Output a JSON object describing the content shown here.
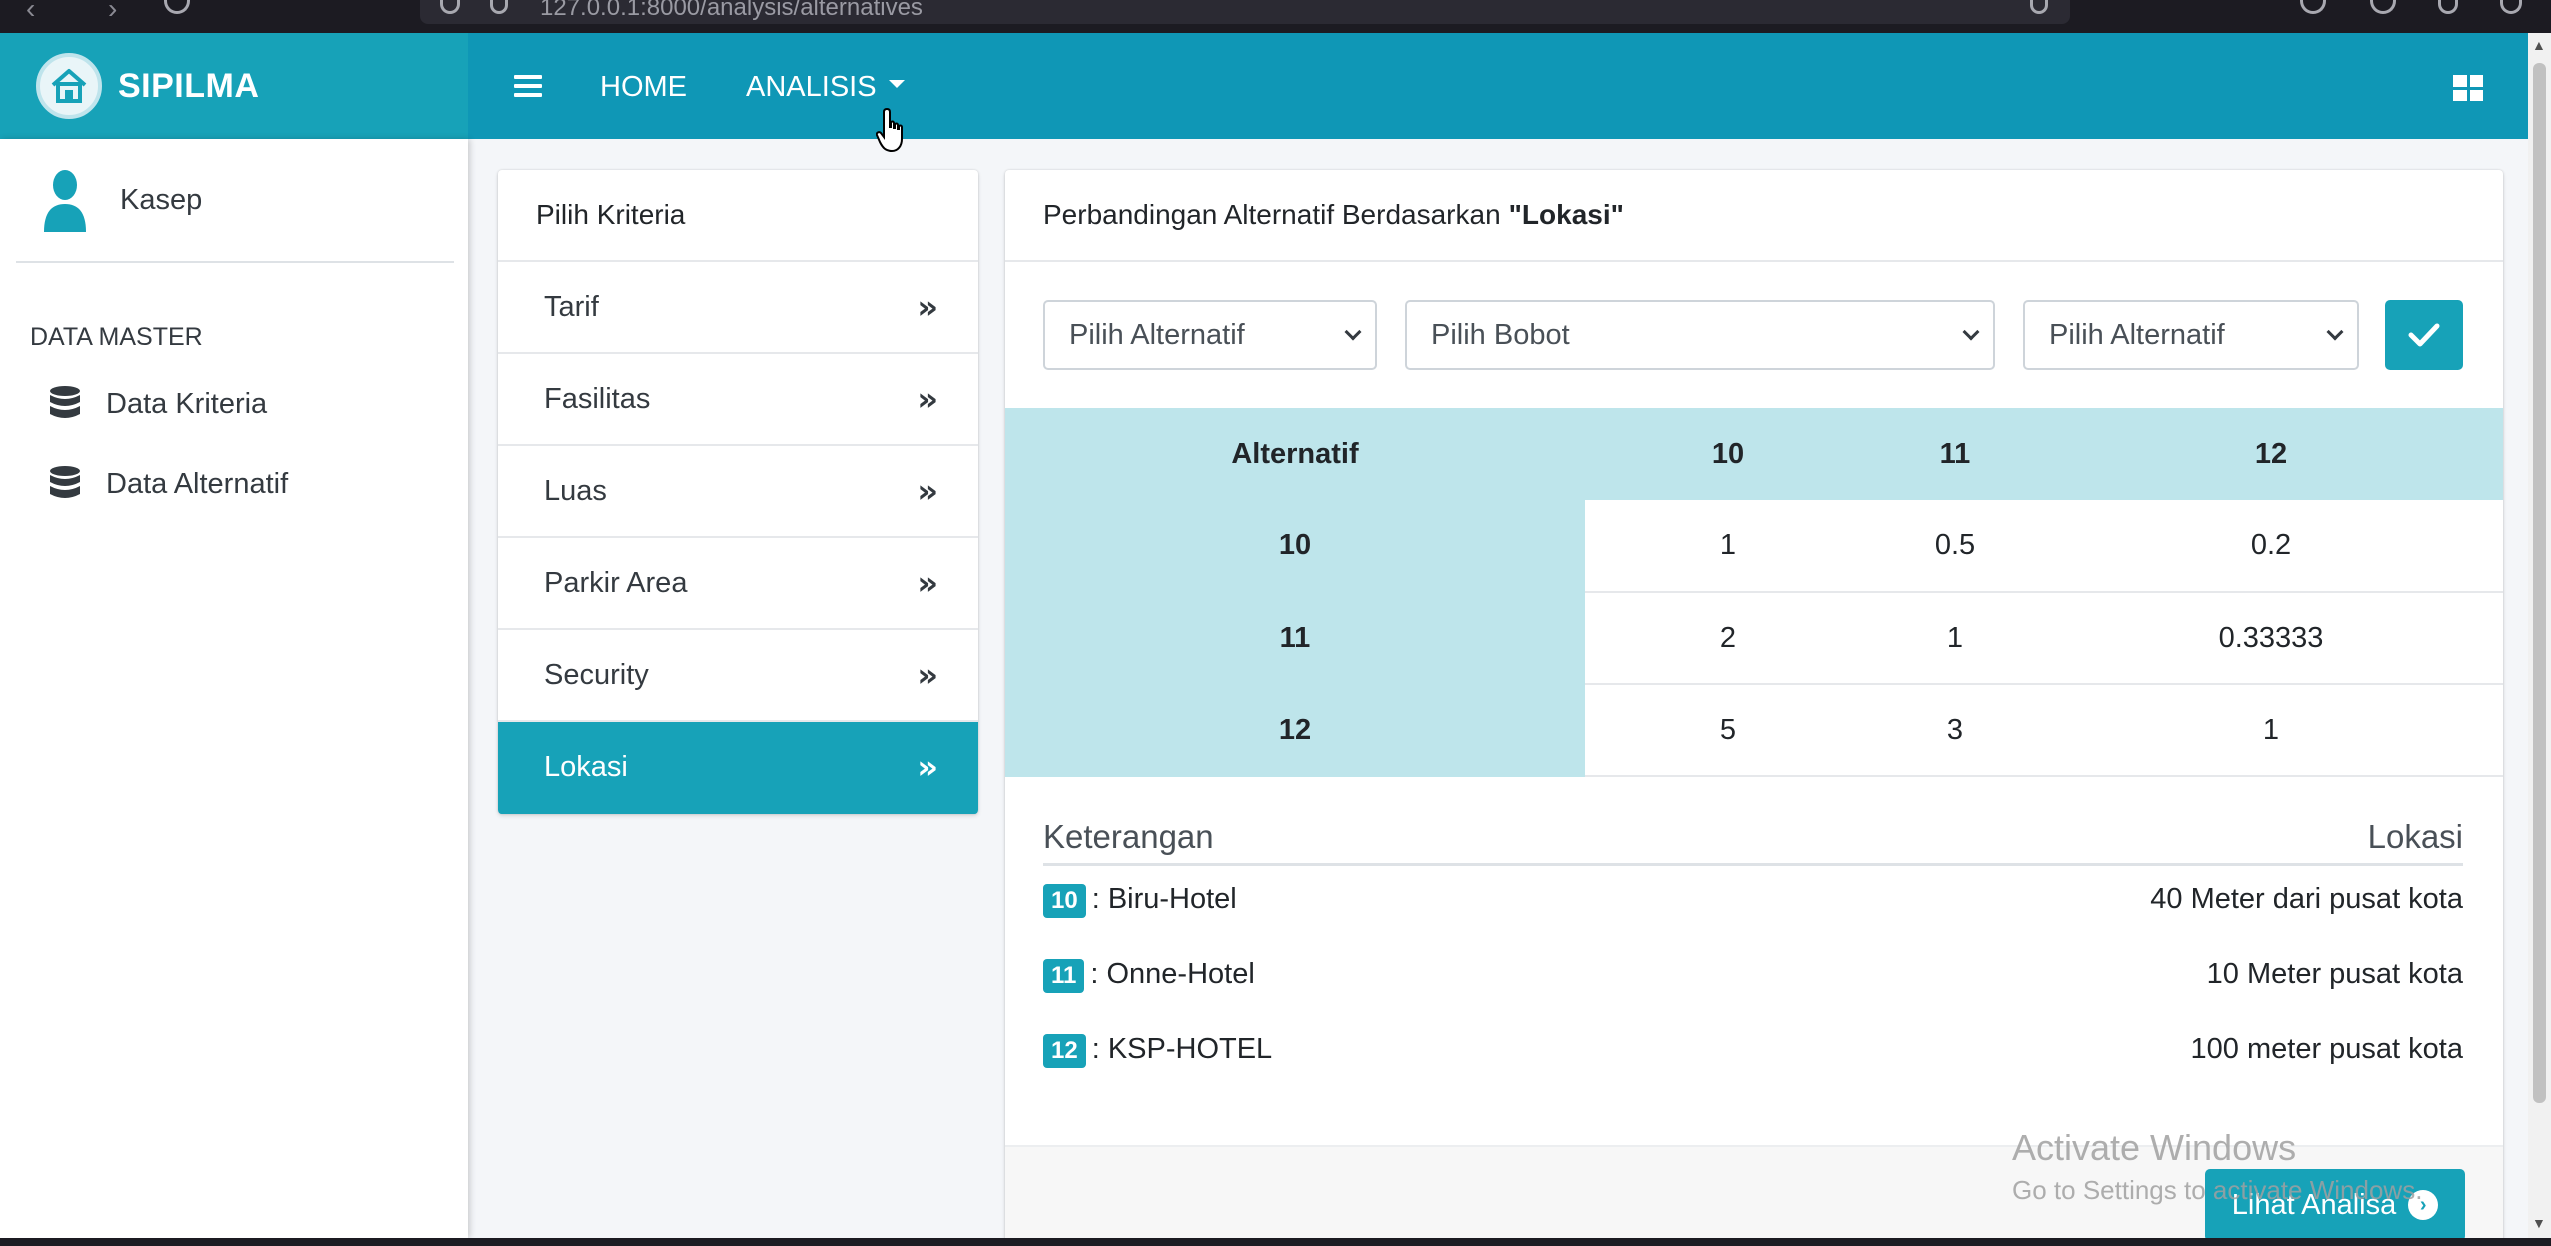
{
  "browser": {
    "url": "127.0.0.1:8000/analysis/alternatives"
  },
  "app": {
    "brand": "SIPILMA"
  },
  "topnav": {
    "home": "HOME",
    "analisis": "ANALISIS"
  },
  "sidebar": {
    "user": "Kasep",
    "section": "DATA MASTER",
    "items": [
      {
        "label": "Data Kriteria"
      },
      {
        "label": "Data Alternatif"
      }
    ]
  },
  "kriteria": {
    "title": "Pilih Kriteria",
    "items": [
      {
        "label": "Tarif"
      },
      {
        "label": "Fasilitas"
      },
      {
        "label": "Luas"
      },
      {
        "label": "Parkir Area"
      },
      {
        "label": "Security"
      },
      {
        "label": "Lokasi"
      }
    ],
    "active": "Lokasi"
  },
  "comparison": {
    "title_prefix": "Perbandingan Alternatif Berdasarkan",
    "criterion": "\"Lokasi\"",
    "select_left": "Pilih Alternatif",
    "select_weight": "Pilih Bobot",
    "select_right": "Pilih Alternatif",
    "table": {
      "corner": "Alternatif",
      "columns": [
        "10",
        "11",
        "12"
      ],
      "rows": [
        {
          "label": "10",
          "values": [
            "1",
            "0.5",
            "0.2"
          ]
        },
        {
          "label": "11",
          "values": [
            "2",
            "1",
            "0.33333"
          ]
        },
        {
          "label": "12",
          "values": [
            "5",
            "3",
            "1"
          ]
        }
      ]
    },
    "keterangan": {
      "left_title": "Keterangan",
      "right_title": "Lokasi",
      "rows": [
        {
          "id": "10",
          "name": ": Biru-Hotel",
          "value": "40 Meter dari pusat kota"
        },
        {
          "id": "11",
          "name": ": Onne-Hotel",
          "value": "10 Meter pusat kota"
        },
        {
          "id": "12",
          "name": ": KSP-HOTEL",
          "value": "100 meter pusat kota"
        }
      ]
    },
    "button": "Lihat Analisa"
  },
  "watermark": {
    "title": "Activate Windows",
    "subtitle": "Go to Settings to activate Windows."
  },
  "colors": {
    "accent": "#17a2b8",
    "navbar": "#0f97b6",
    "table_header": "#bee5eb"
  }
}
